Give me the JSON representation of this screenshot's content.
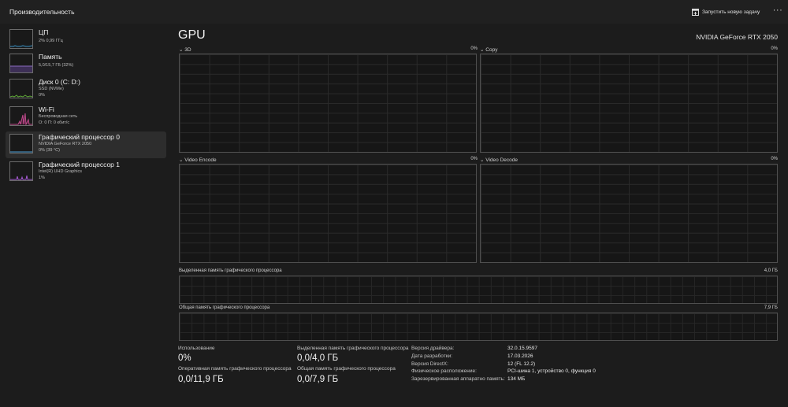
{
  "window": {
    "title": "Производительность",
    "run_task_label": "Запустить новую задачу",
    "more_label": "···"
  },
  "sidebar": {
    "items": [
      {
        "name": "ЦП",
        "lines": [
          "2% 0,99 ГГц"
        ],
        "thumb_color": "#3a94c8",
        "selected": false
      },
      {
        "name": "Память",
        "lines": [
          "5,0/15,7 ГБ (32%)"
        ],
        "thumb_color": "#8a6bc0",
        "selected": false
      },
      {
        "name": "Диск 0 (C: D:)",
        "lines": [
          "SSD (NVMe)",
          "0%"
        ],
        "thumb_color": "#5ea836",
        "selected": false
      },
      {
        "name": "Wi-Fi",
        "lines": [
          "Беспроводная сеть",
          "О: 0 П: 0 кбит/с"
        ],
        "thumb_color": "#c04a8c",
        "selected": false
      },
      {
        "name": "Графический процессор 0",
        "lines": [
          "NVIDIA GeForce RTX 2050",
          "0% (39 °C)"
        ],
        "thumb_color": "#4aa0d6",
        "selected": true
      },
      {
        "name": "Графический процессор 1",
        "lines": [
          "Intel(R) UHD Graphics",
          "1%"
        ],
        "thumb_color": "#a35ad0",
        "selected": false
      }
    ]
  },
  "main": {
    "title": "GPU",
    "model": "NVIDIA GeForce RTX 2050",
    "engines": [
      {
        "label": "3D",
        "percent": "0%"
      },
      {
        "label": "Copy",
        "percent": "0%"
      },
      {
        "label": "Video Encode",
        "percent": "0%"
      },
      {
        "label": "Video Decode",
        "percent": "0%"
      }
    ],
    "dedicated_memory": {
      "label": "Выделенная память графического процессора",
      "max": "4,0 ГБ"
    },
    "shared_memory": {
      "label": "Общая память графического процессора",
      "max": "7,9 ГБ"
    },
    "stats": {
      "usage_label": "Использование",
      "usage_value": "0%",
      "dedicated_label": "Выделенная память графического процессора",
      "dedicated_value": "0,0/4,0 ГБ",
      "gpu_ram_label": "Оперативная память графического процессора",
      "gpu_ram_value": "0,0/11,9 ГБ",
      "shared_label": "Общая память графического процессора",
      "shared_value": "0,0/7,9 ГБ"
    },
    "info": [
      {
        "label": "Версия драйвера:",
        "value": "32.0.15.9597"
      },
      {
        "label": "Дата разработки:",
        "value": "17.03.2026"
      },
      {
        "label": "Версия DirectX:",
        "value": "12 (FL 12.2)"
      },
      {
        "label": "Физическое расположение:",
        "value": "PCI-шина 1, устройство 0, функция 0"
      },
      {
        "label": "Зарезервированная аппаратно память:",
        "value": "134 МБ"
      }
    ]
  }
}
